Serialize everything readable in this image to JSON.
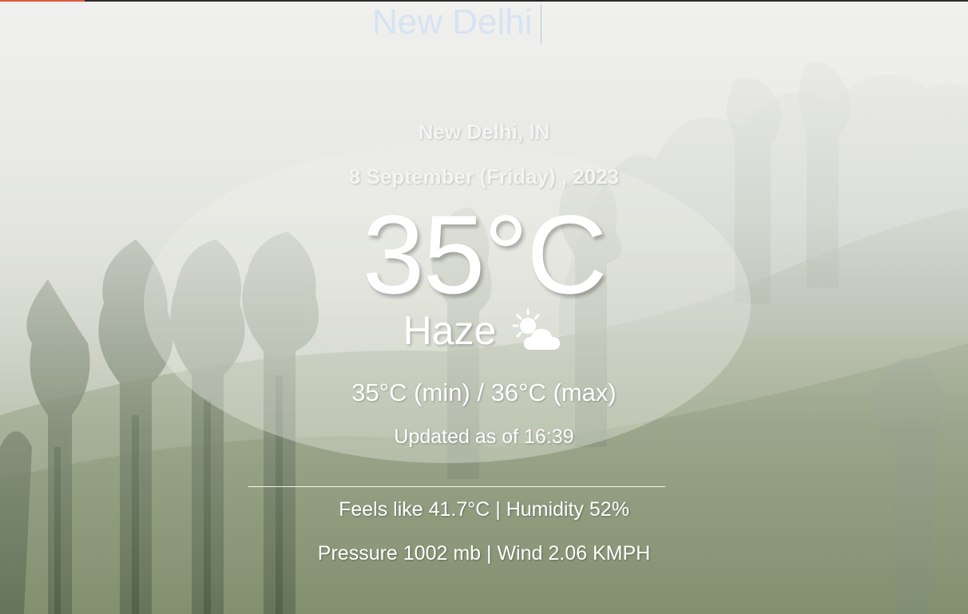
{
  "search": {
    "value": "New Delhi"
  },
  "weather": {
    "location": "New Delhi, IN",
    "date": "8 September (Friday) , 2023",
    "temperature": "35°C",
    "condition": "Haze",
    "condition_icon": "sun-behind-cloud-icon",
    "min_max": "35°C (min) / 36°C (max)",
    "updated": "Updated as of 16:39",
    "feels_humidity": "Feels like 41.7°C | Humidity 52%",
    "pressure_wind": "Pressure 1002 mb | Wind 2.06 KMPH"
  },
  "colors": {
    "accent": "#e2583e",
    "search_text": "#d6e3f2",
    "foreground": "#ffffff"
  }
}
